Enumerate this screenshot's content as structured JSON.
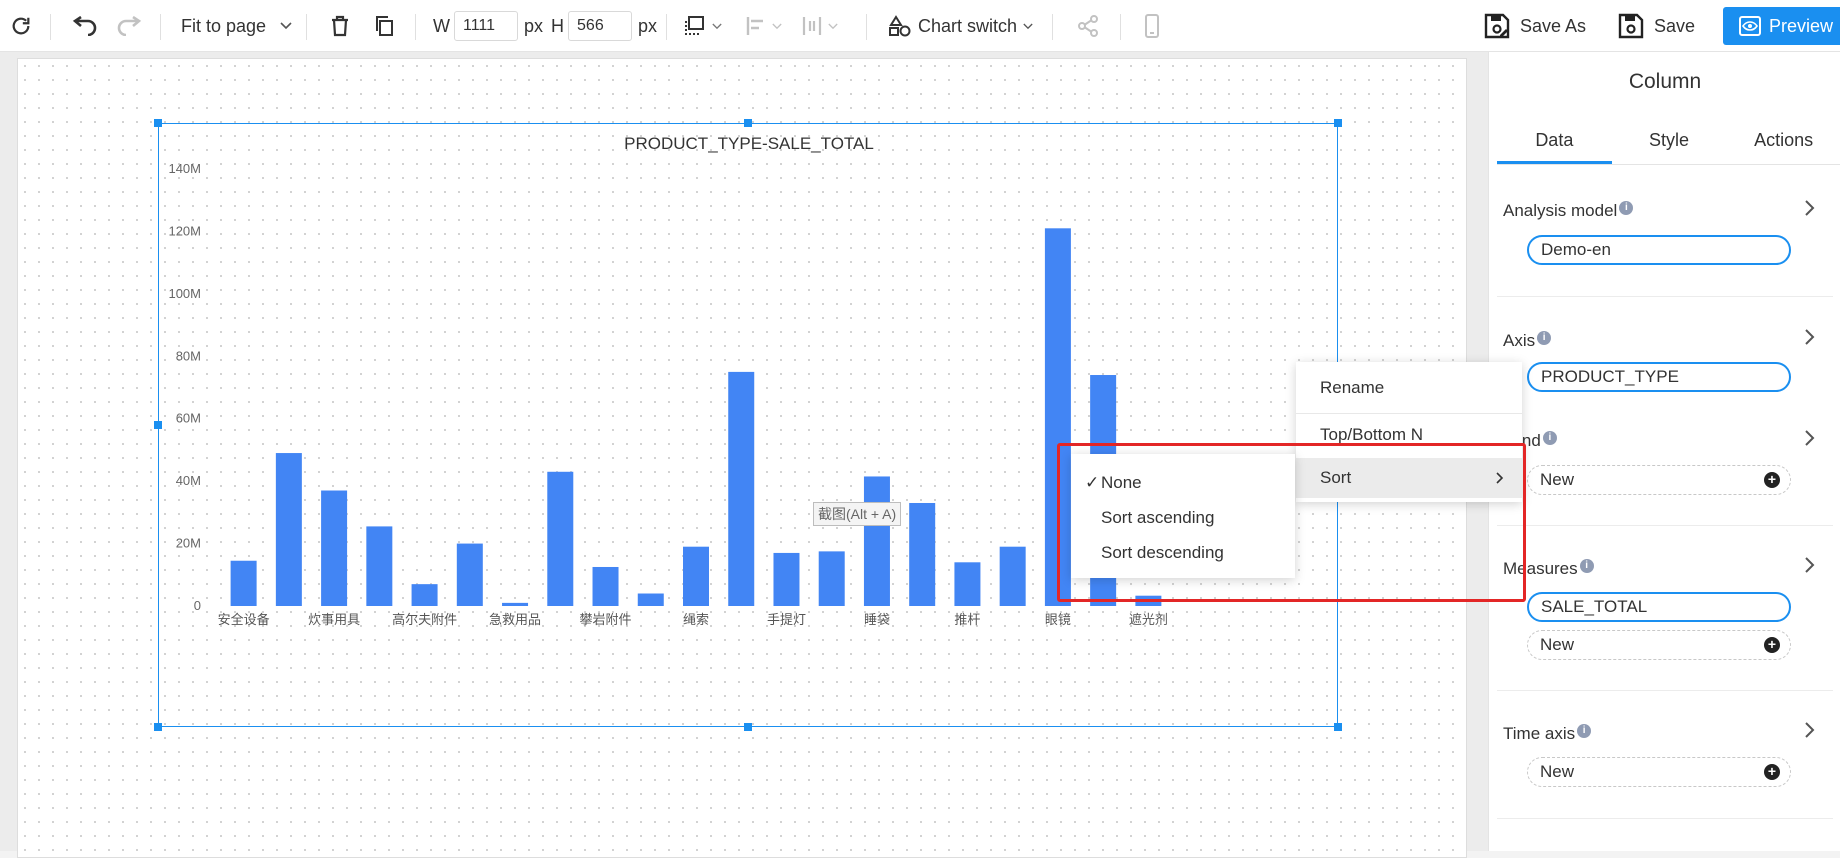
{
  "toolbar": {
    "refresh_icon": "refresh-icon",
    "undo_icon": "undo-icon",
    "redo_icon": "redo-icon",
    "zoom_label": "Fit to page",
    "delete_icon": "trash-icon",
    "copy_icon": "copy-icon",
    "width_label": "W",
    "width_value": "1111",
    "width_unit": "px",
    "height_label": "H",
    "height_value": "566",
    "height_unit": "px",
    "chart_switch_label": "Chart switch",
    "save_as_label": "Save As",
    "save_label": "Save",
    "preview_label": "Preview",
    "accent_color": "#1a8ff0"
  },
  "panel": {
    "title": "Column",
    "tabs": [
      "Data",
      "Style",
      "Actions"
    ],
    "active_tab": "Data",
    "analysis_model": {
      "label": "Analysis model",
      "value": "Demo-en"
    },
    "axis": {
      "label": "Axis",
      "value": "PRODUCT_TYPE"
    },
    "legend": {
      "label": "gend",
      "new_label": "New"
    },
    "measures": {
      "label": "Measures",
      "value": "SALE_TOTAL",
      "new_label": "New"
    },
    "time_axis": {
      "label": "Time axis",
      "new_label": "New"
    }
  },
  "context_menu": {
    "items": [
      "Rename",
      "Top/Bottom N",
      "Sort"
    ],
    "sort_submenu": {
      "items": [
        "None",
        "Sort ascending",
        "Sort descending"
      ],
      "selected": "None",
      "check": "✓"
    }
  },
  "screenshot_tip": "截图(Alt + A)",
  "chart_data": {
    "type": "bar",
    "title": "PRODUCT_TYPE-SALE_TOTAL",
    "categories": [
      "安全设备",
      "",
      "炊事用具",
      "",
      "高尔夫附件",
      "",
      "急救用品",
      "",
      "攀岩附件",
      "",
      "绳索",
      "",
      "手提灯",
      "",
      "睡袋",
      "",
      "推杆",
      "",
      "眼镜",
      "",
      "遮光剂"
    ],
    "values": [
      14.5,
      49,
      37,
      25.5,
      7,
      20,
      1,
      43,
      12.5,
      4,
      19,
      75,
      17,
      17.5,
      41.5,
      33,
      14,
      19,
      121,
      74,
      3.3
    ],
    "ylim": [
      0,
      140
    ],
    "yticks": [
      "0",
      "20M",
      "40M",
      "60M",
      "80M",
      "100M",
      "120M",
      "140M"
    ],
    "bar_color": "#4285f4",
    "xlabel": "",
    "ylabel": ""
  }
}
